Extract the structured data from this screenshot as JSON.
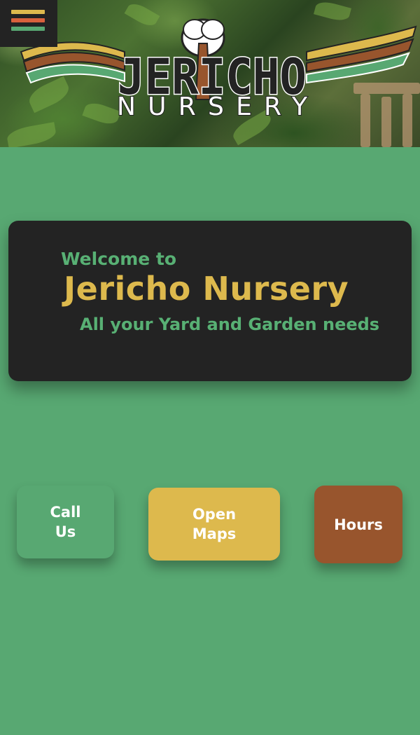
{
  "header": {
    "menu_icon": "hamburger-menu-icon",
    "menu_bar_colors": [
      "#ddb94d",
      "#d8613d",
      "#58a872"
    ],
    "logo": {
      "word_top": "JERICHO",
      "word_bottom": "NURSERY",
      "stripe_colors": [
        "#ddb94d",
        "#98552d",
        "#58a872"
      ]
    }
  },
  "hero_card": {
    "welcome": "Welcome to",
    "business_name": "Jericho Nursery",
    "tagline": "All your Yard and Garden needs"
  },
  "actions": {
    "call": {
      "line1": "Call",
      "line2": "Us"
    },
    "maps": {
      "line1": "Open",
      "line2": "Maps"
    },
    "hours": {
      "label": "Hours"
    }
  },
  "colors": {
    "background": "#58a872",
    "card": "#232323",
    "gold": "#ddb94d",
    "brown": "#98552d",
    "green": "#58a872"
  }
}
